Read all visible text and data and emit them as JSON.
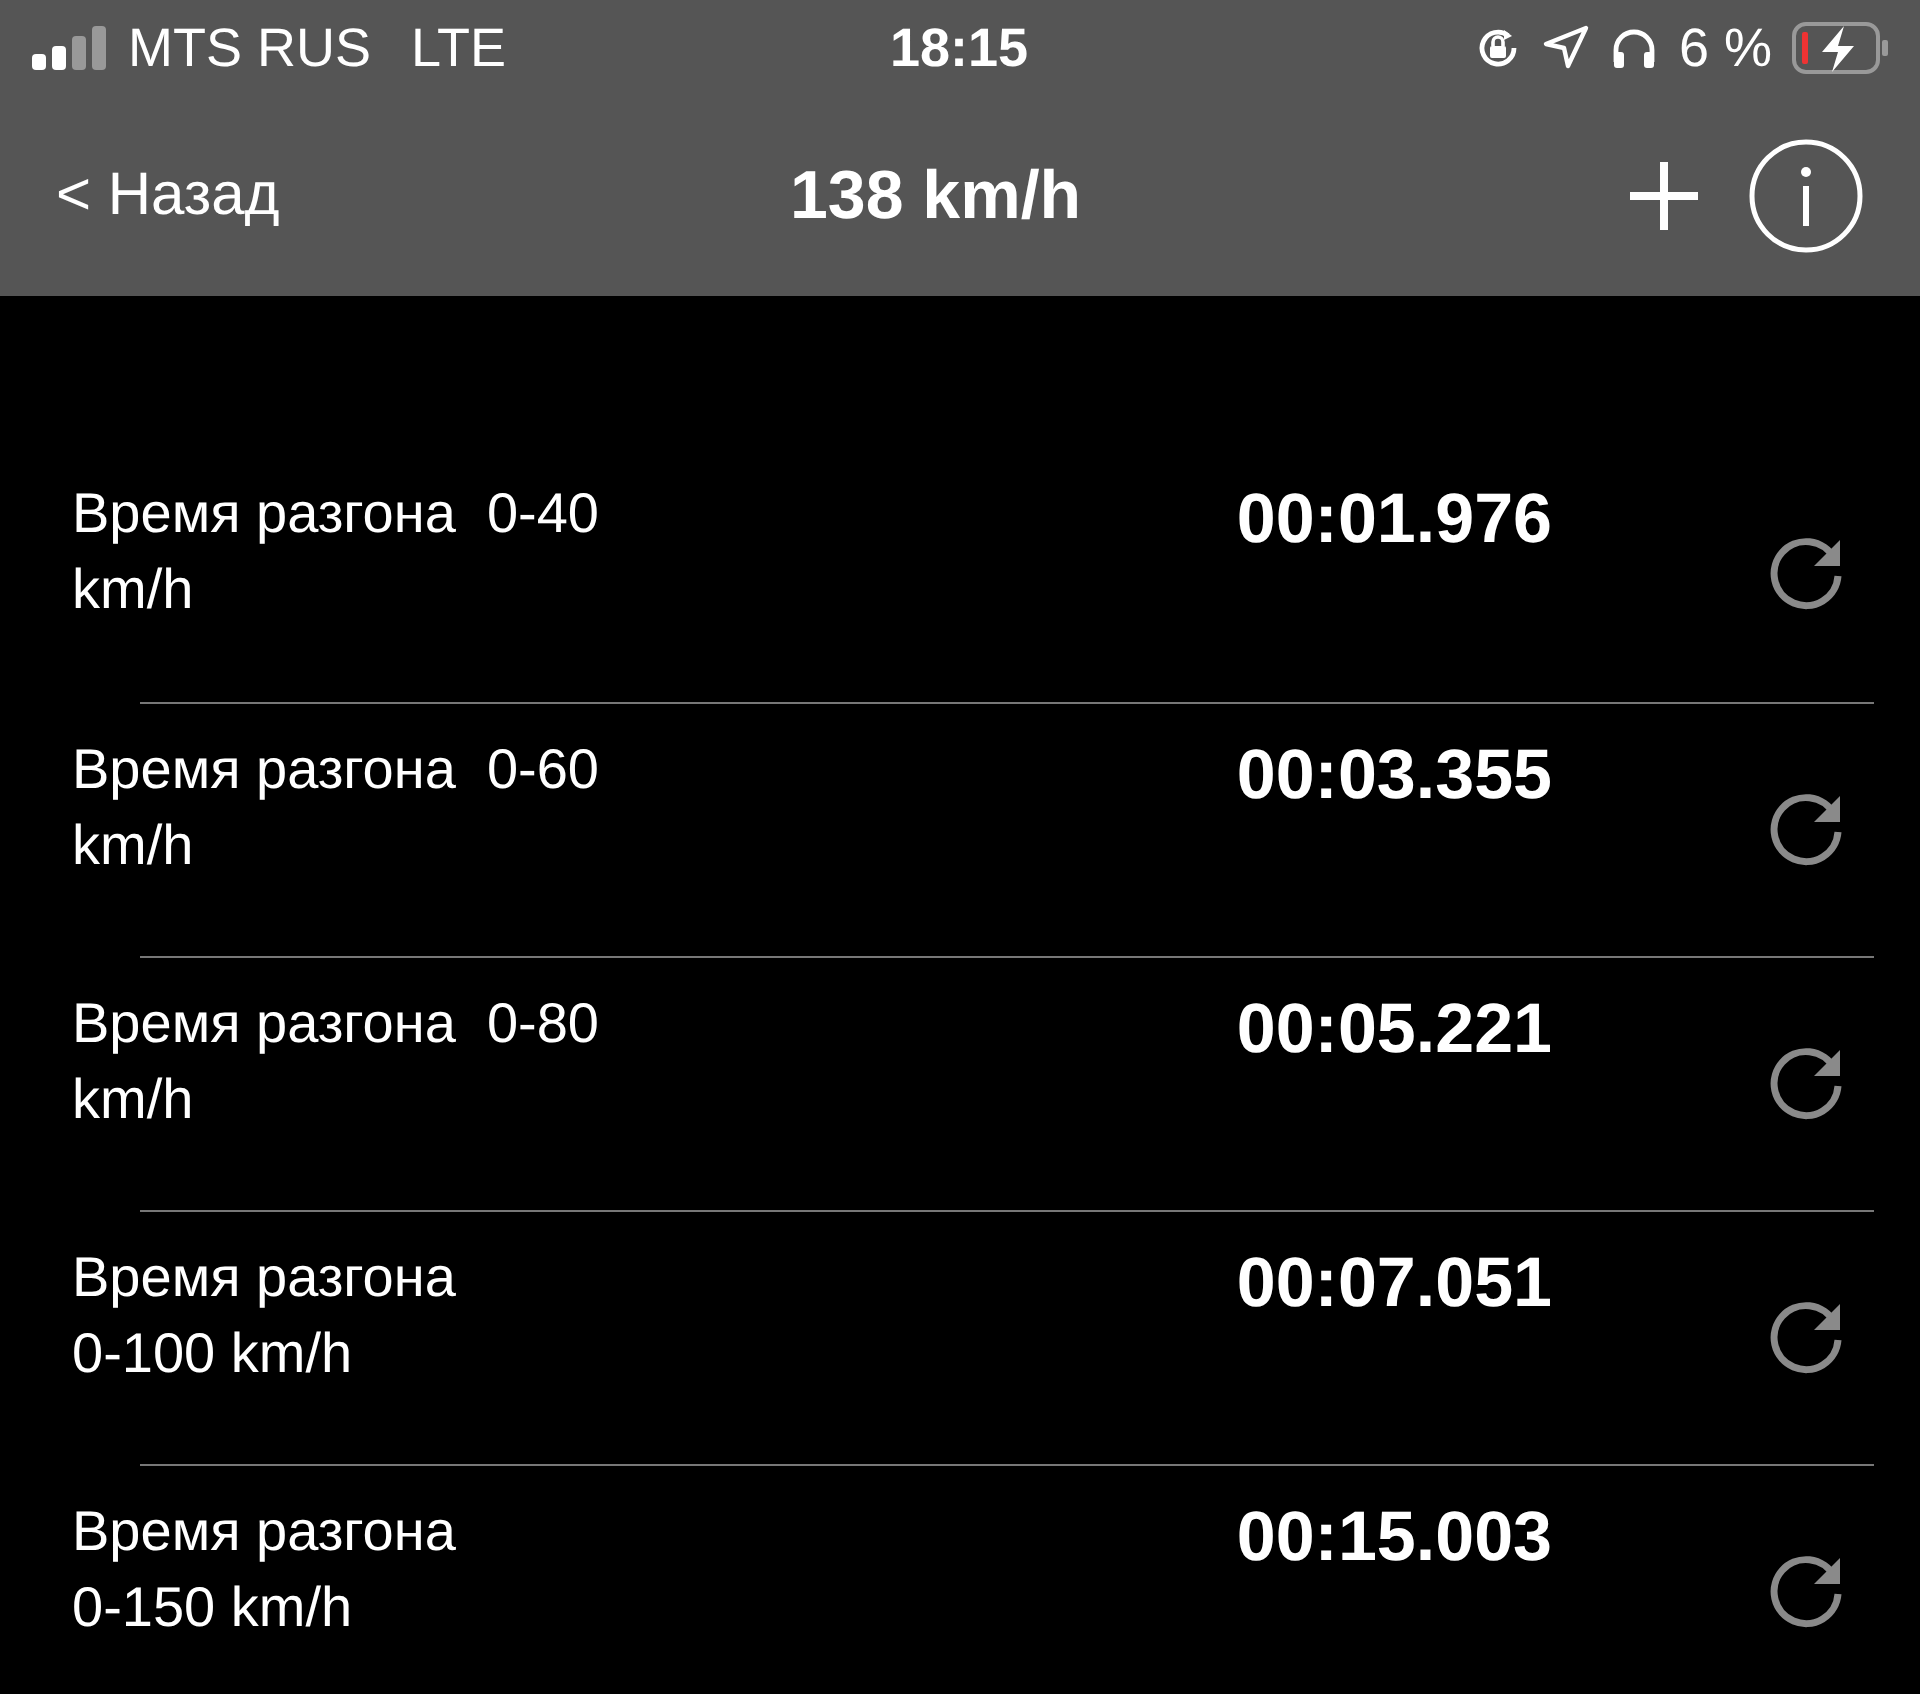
{
  "status_bar": {
    "carrier": "MTS RUS",
    "network": "LTE",
    "time": "18:15",
    "battery_percent": "6 %"
  },
  "nav_bar": {
    "back": "< Назад",
    "title": "138 km/h"
  },
  "rows": [
    {
      "label_lines": [
        "Время разгона  0-40",
        "km/h"
      ],
      "time": "00:01.976"
    },
    {
      "label_lines": [
        "Время разгона  0-60",
        "km/h"
      ],
      "time": "00:03.355"
    },
    {
      "label_lines": [
        "Время разгона  0-80",
        "km/h"
      ],
      "time": "00:05.221"
    },
    {
      "label_lines": [
        "Время разгона",
        "0-100 km/h"
      ],
      "time": "00:07.051"
    },
    {
      "label_lines": [
        "Время разгона",
        "0-150 km/h"
      ],
      "time": "00:15.003"
    }
  ]
}
